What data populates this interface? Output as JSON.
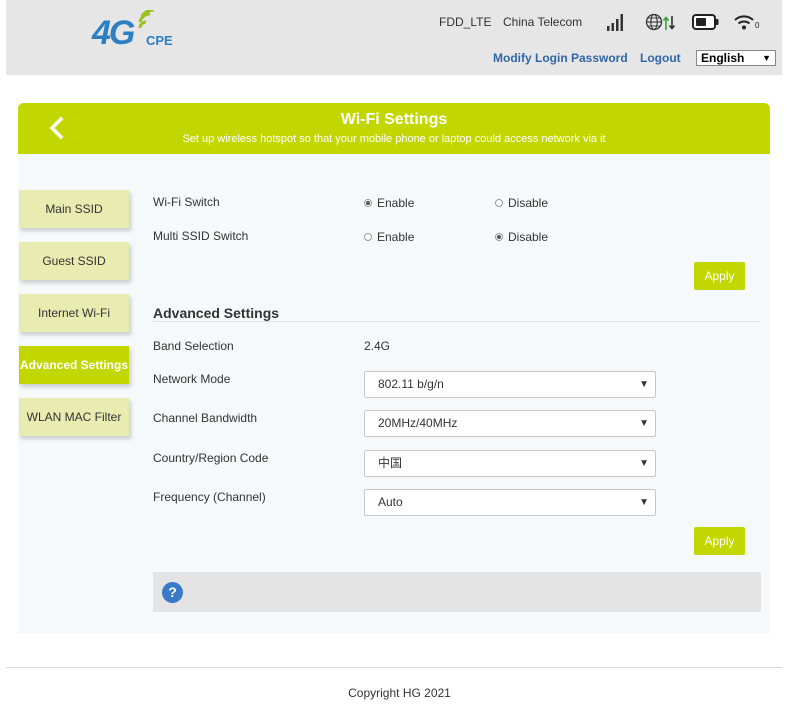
{
  "header": {
    "logo_main": "4G",
    "logo_sub": "CPE",
    "network_type": "FDD_LTE",
    "operator": "China Telecom",
    "links": {
      "modify_password": "Modify Login Password",
      "logout": "Logout"
    },
    "language": "English",
    "icons": [
      "signal-icon",
      "globe-data-icon",
      "battery-icon",
      "wifi-icon"
    ],
    "wifi_clients": "0"
  },
  "banner": {
    "title": "Wi-Fi Settings",
    "subtitle": "Set up wireless hotspot so that your mobile phone or laptop could access network via it"
  },
  "sidebar": {
    "items": [
      {
        "label": "Main SSID",
        "active": false
      },
      {
        "label": "Guest SSID",
        "active": false
      },
      {
        "label": "Internet Wi-Fi",
        "active": false
      },
      {
        "label": "Advanced Settings",
        "active": true
      },
      {
        "label": "WLAN MAC Filter",
        "active": false
      }
    ]
  },
  "switches": {
    "wifi_switch": {
      "label": "Wi-Fi Switch",
      "enable": "Enable",
      "disable": "Disable",
      "selected": "enable"
    },
    "multi_ssid_switch": {
      "label": "Multi SSID Switch",
      "enable": "Enable",
      "disable": "Disable",
      "selected": "disable"
    },
    "apply_label": "Apply"
  },
  "advanced": {
    "title": "Advanced Settings",
    "band_label": "Band Selection",
    "band_value": "2.4G",
    "network_mode_label": "Network Mode",
    "network_mode_value": "802.11 b/g/n",
    "channel_bandwidth_label": "Channel Bandwidth",
    "channel_bandwidth_value": "20MHz/40MHz",
    "country_label": "Country/Region Code",
    "country_value": "中国",
    "frequency_label": "Frequency (Channel)",
    "frequency_value": "Auto",
    "apply_label": "Apply"
  },
  "help": {
    "icon_text": "?"
  },
  "footer": {
    "copyright": "Copyright HG 2021"
  },
  "colors": {
    "accent": "#c2d700",
    "sidebar_inactive": "#e8ecb0",
    "link": "#3166a8",
    "logo": "#2c7fc2"
  }
}
